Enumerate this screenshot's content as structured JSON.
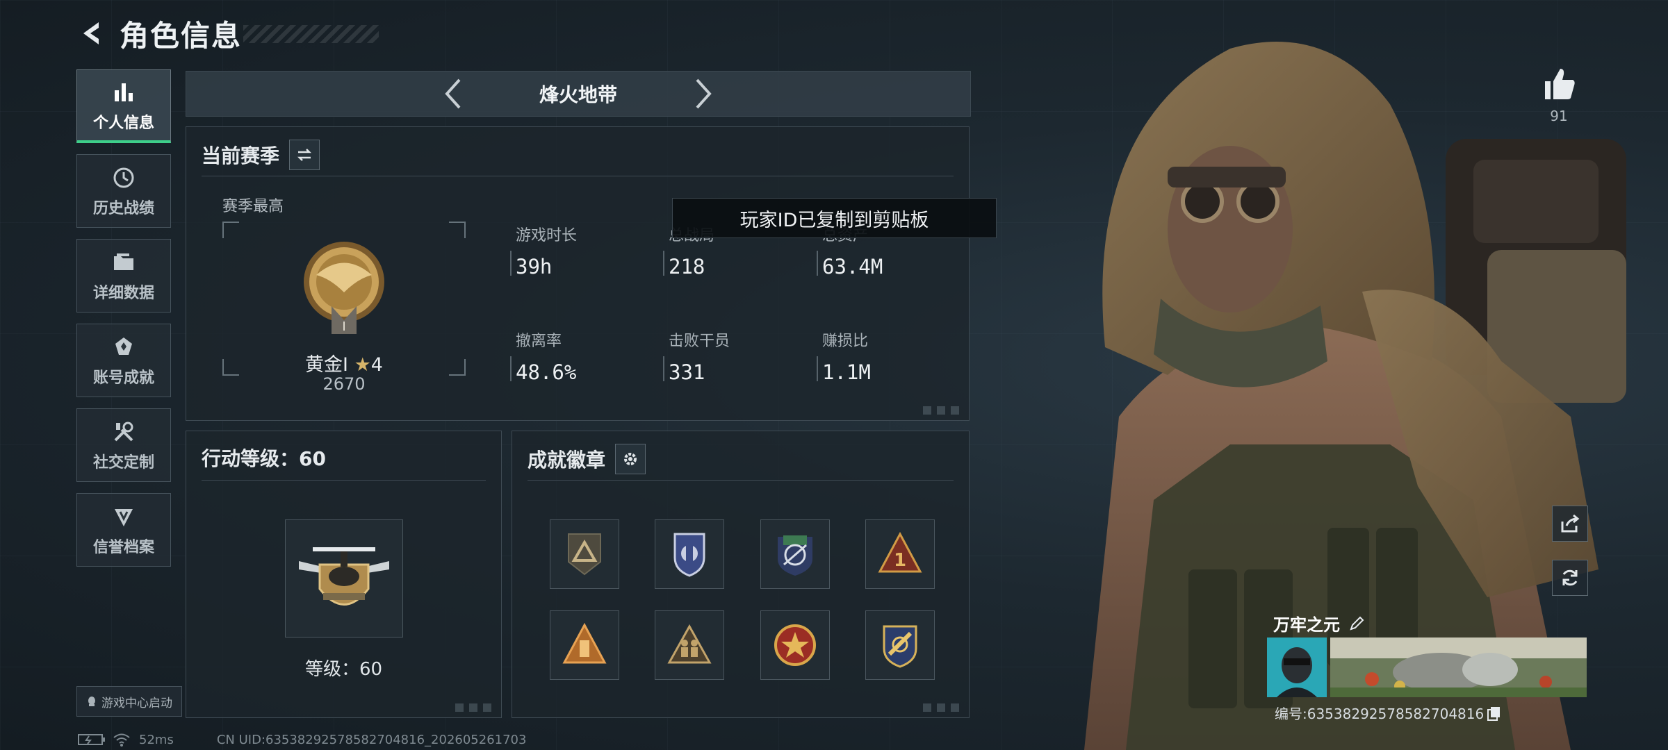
{
  "header": {
    "title": "角色信息"
  },
  "sidenav": {
    "items": [
      {
        "label": "个人信息",
        "icon": "bar-chart-icon",
        "active": true
      },
      {
        "label": "历史战绩",
        "icon": "history-icon",
        "active": false
      },
      {
        "label": "详细数据",
        "icon": "folder-icon",
        "active": false
      },
      {
        "label": "账号成就",
        "icon": "achievement-icon",
        "active": false
      },
      {
        "label": "社交定制",
        "icon": "tools-icon",
        "active": false
      },
      {
        "label": "信誉档案",
        "icon": "credit-shield-icon",
        "active": false
      }
    ],
    "launch_label": "游戏中心启动"
  },
  "mode": {
    "name": "烽火地带"
  },
  "season": {
    "title": "当前赛季",
    "best_label": "赛季最高",
    "rank_name": "黄金I",
    "rank_stars": "4",
    "rank_score": "2670",
    "stats": [
      {
        "label": "游戏时长",
        "value": "39h"
      },
      {
        "label": "总战局",
        "value": "218"
      },
      {
        "label": "总资产",
        "value": "63.4M"
      },
      {
        "label": "撤离率",
        "value": "48.6%"
      },
      {
        "label": "击败干员",
        "value": "331"
      },
      {
        "label": "赚损比",
        "value": "1.1M"
      }
    ]
  },
  "toast": {
    "text": "玩家ID已复制到剪贴板"
  },
  "action_level": {
    "title": "行动等级：60",
    "level_label": "等级：60"
  },
  "achievements": {
    "title": "成就徽章",
    "badges": [
      "badge-triangle-icon",
      "badge-shield-icon",
      "badge-crosshair-icon",
      "badge-one-icon",
      "badge-tower-icon",
      "badge-soldiers-icon",
      "badge-star-icon",
      "badge-wrench-icon"
    ]
  },
  "player": {
    "likes": "91",
    "name": "万牢之元",
    "id_text": "编号:6353829257858270481​6"
  },
  "footer": {
    "ping": "52ms",
    "uid": "CN UID:63538292578582704816_202605261703"
  },
  "colors": {
    "accent": "#3ecf8a",
    "gold": "#c9a25b",
    "panel": "#1c252c"
  }
}
